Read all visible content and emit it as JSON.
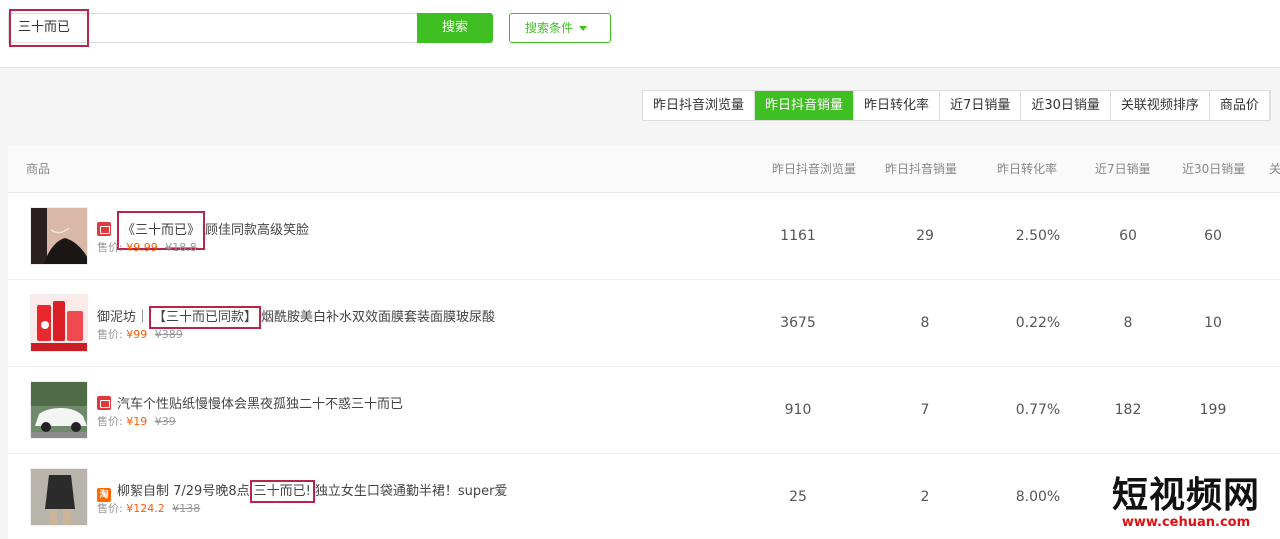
{
  "search": {
    "query": "三十而已",
    "button": "搜索",
    "conditions": "搜索条件"
  },
  "sort_tabs": [
    {
      "label": "昨日抖音浏览量",
      "active": false
    },
    {
      "label": "昨日抖音销量",
      "active": true
    },
    {
      "label": "昨日转化率",
      "active": false
    },
    {
      "label": "近7日销量",
      "active": false
    },
    {
      "label": "近30日销量",
      "active": false
    },
    {
      "label": "关联视频排序",
      "active": false
    },
    {
      "label": "商品价",
      "active": false
    }
  ],
  "table": {
    "headers": {
      "product": "商品",
      "views": "昨日抖音浏览量",
      "sales": "昨日抖音销量",
      "conv": "昨日转化率",
      "d7": "近7日销量",
      "d30": "近30日销量",
      "more": "关"
    },
    "rows": [
      {
        "title_pre": "",
        "title_hl": "《三十而已》",
        "title_post": "顾佳同款高级笑脸",
        "price_label": "售价:",
        "price": "¥9.99",
        "old_price": "¥18.8",
        "views": "1161",
        "sales": "29",
        "conv": "2.50%",
        "d7": "60",
        "d30": "60"
      },
      {
        "title_pre": "御泥坊｜",
        "title_hl": "【三十而已同款】",
        "title_post": "烟酰胺美白补水双效面膜套装面膜玻尿酸",
        "price_label": "售价:",
        "price": "¥99",
        "old_price": "¥389",
        "views": "3675",
        "sales": "8",
        "conv": "0.22%",
        "d7": "8",
        "d30": "10"
      },
      {
        "title_pre": "汽车个性贴纸慢慢体会黑夜孤独二十不惑三十而已",
        "title_hl": "",
        "title_post": "",
        "price_label": "售价:",
        "price": "¥19",
        "old_price": "¥39",
        "views": "910",
        "sales": "7",
        "conv": "0.77%",
        "d7": "182",
        "d30": "199"
      },
      {
        "title_pre": "柳絮自制 7/29号晚8点",
        "title_hl": "三十而已!",
        "title_post": "独立女生口袋通勤半裙！super爱",
        "price_label": "售价:",
        "price": "¥124.2",
        "old_price": "¥138",
        "views": "25",
        "sales": "2",
        "conv": "8.00%",
        "d7": "",
        "d30": ""
      }
    ]
  },
  "watermark": {
    "main": "短视频网",
    "sub": "www.cehuan.com"
  },
  "colors": {
    "accent": "#3fbf21",
    "highlight_box": "#b8254a",
    "price": "#ff5a00"
  }
}
